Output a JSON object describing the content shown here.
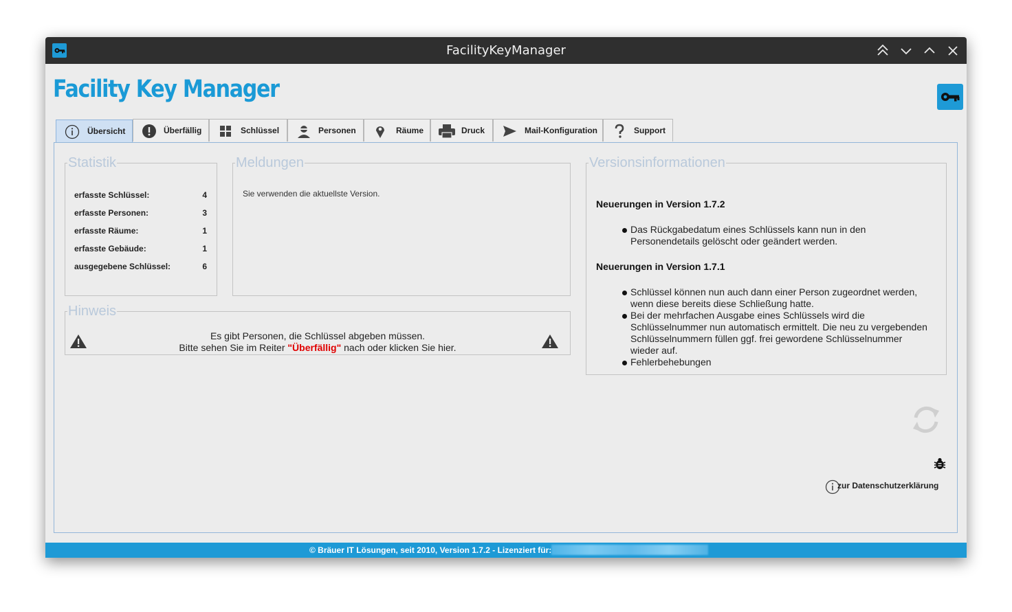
{
  "window": {
    "title": "FacilityKeyManager",
    "controls": [
      "keep-above-icon",
      "minimize-icon",
      "maximize-icon",
      "close-icon"
    ]
  },
  "header": {
    "app_title": "Facility Key Manager",
    "logo_icon": "key-icon"
  },
  "tabs": [
    {
      "label": "Übersicht",
      "icon": "info-icon",
      "active": true
    },
    {
      "label": "Überfällig",
      "icon": "alert-circle-icon"
    },
    {
      "label": "Schlüssel",
      "icon": "grid-icon"
    },
    {
      "label": "Personen",
      "icon": "person-icon"
    },
    {
      "label": "Räume",
      "icon": "map-pin-icon"
    },
    {
      "label": "Druck",
      "icon": "printer-icon"
    },
    {
      "label": "Mail-Konfiguration",
      "icon": "send-icon"
    },
    {
      "label": "Support",
      "icon": "question-icon"
    }
  ],
  "statistik": {
    "legend": "Statistik",
    "rows": [
      {
        "label": "erfasste Schlüssel:",
        "value": "4"
      },
      {
        "label": "erfasste Personen:",
        "value": "3"
      },
      {
        "label": "erfasste Räume:",
        "value": "1"
      },
      {
        "label": "erfasste Gebäude:",
        "value": "1"
      },
      {
        "label": "ausgegebene Schlüssel:",
        "value": "6"
      }
    ]
  },
  "meldungen": {
    "legend": "Meldungen",
    "message": "Sie verwenden die aktuellste Version."
  },
  "hinweis": {
    "legend": "Hinweis",
    "line1": "Es gibt Personen, die Schlüssel abgeben müssen.",
    "line2_prefix": "Bitte sehen Sie im Reiter ",
    "line2_link": "\"Überfällig\"",
    "line2_suffix": " nach oder klicken Sie hier.",
    "icon": "warning-icon"
  },
  "versions": {
    "legend": "Versionsinformationen",
    "sections": [
      {
        "heading": "Neuerungen in Version 1.7.2",
        "items": [
          "Das Rückgabedatum eines Schlüssels kann nun in den Personendetails gelöscht oder geändert werden."
        ]
      },
      {
        "heading": "Neuerungen in Version 1.7.1",
        "items": [
          "Schlüssel können nun auch dann einer Person zugeordnet werden, wenn diese bereits diese Schließung hatte.",
          "Bei der mehrfachen Ausgabe eines Schlüssels wird die Schlüsselnummer nun automatisch ermittelt. Die neu zu vergebenden Schlüsselnummern füllen ggf. frei gewordene Schlüsselnummer wieder auf.",
          "Fehlerbehebungen"
        ]
      }
    ]
  },
  "tools": {
    "refresh_icon": "refresh-icon",
    "bug_icon": "bug-icon"
  },
  "privacy": {
    "label": "zur Datenschutzerklärung",
    "icon": "info-icon"
  },
  "footer": {
    "text": "© Bräuer IT Lösungen, seit 2010, Version 1.7.2 - Lizenziert für:"
  }
}
